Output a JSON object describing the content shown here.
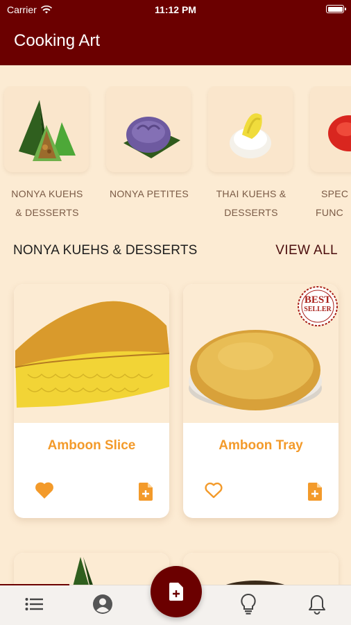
{
  "status_bar": {
    "carrier": "Carrier",
    "time": "11:12 PM"
  },
  "header": {
    "title": "Cooking Art"
  },
  "categories": [
    {
      "label_line1": "NONYA KUEHS",
      "label_line2": "& DESSERTS"
    },
    {
      "label_line1": "NONYA PETITES",
      "label_line2": ""
    },
    {
      "label_line1": "THAI KUEHS &",
      "label_line2": "DESSERTS"
    },
    {
      "label_line1": "SPEC",
      "label_line2": "FUNC"
    }
  ],
  "section": {
    "title": "NONYA KUEHS & DESSERTS",
    "view_all": "VIEW ALL"
  },
  "products": [
    {
      "name": "Amboon Slice",
      "favorite": true,
      "badge": ""
    },
    {
      "name": "Amboon Tray",
      "favorite": false,
      "badge_line1": "BEST",
      "badge_line2": "SELLER"
    }
  ],
  "tabs": [
    {
      "icon": "list-icon"
    },
    {
      "icon": "profile-icon"
    },
    {
      "icon": "add-order-icon"
    },
    {
      "icon": "lightbulb-icon"
    },
    {
      "icon": "bell-icon"
    }
  ],
  "colors": {
    "header": "#6b0000",
    "background": "#fcebd3",
    "accent": "#f39a2a",
    "card": "#ffffff"
  }
}
